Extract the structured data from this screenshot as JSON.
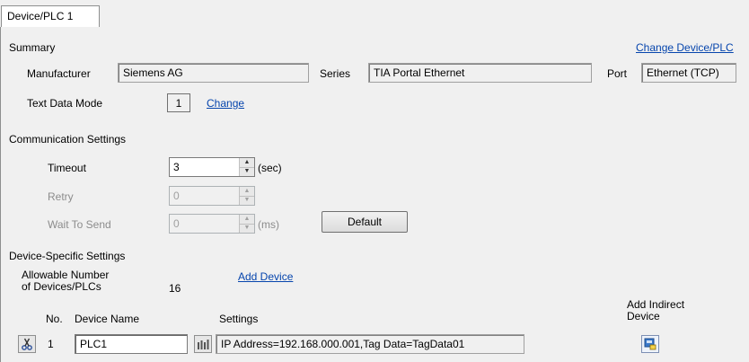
{
  "tab": {
    "label": "Device/PLC 1"
  },
  "summary": {
    "heading": "Summary",
    "change_link": "Change Device/PLC",
    "manufacturer_label": "Manufacturer",
    "manufacturer_value": "Siemens AG",
    "series_label": "Series",
    "series_value": "TIA Portal Ethernet",
    "port_label": "Port",
    "port_value": "Ethernet (TCP)",
    "text_data_mode_label": "Text Data Mode",
    "text_data_mode_value": "1",
    "text_data_mode_change": "Change"
  },
  "comm": {
    "heading": "Communication Settings",
    "timeout_label": "Timeout",
    "timeout_value": "3",
    "timeout_unit": "(sec)",
    "retry_label": "Retry",
    "retry_value": "0",
    "wait_label": "Wait To Send",
    "wait_value": "0",
    "wait_unit": "(ms)",
    "default_button": "Default"
  },
  "device_specific": {
    "heading": "Device-Specific Settings",
    "allowable_line1": "Allowable Number",
    "allowable_line2": "of Devices/PLCs",
    "allowable_value": "16",
    "add_device": "Add Device",
    "col_no": "No.",
    "col_device_name": "Device Name",
    "col_settings": "Settings",
    "col_add_indirect_line1": "Add Indirect",
    "col_add_indirect_line2": "Device",
    "rows": [
      {
        "no": "1",
        "device_name": "PLC1",
        "settings": "IP Address=192.168.000.001,Tag Data=TagData01"
      }
    ]
  },
  "icons": {
    "row_cut": "scissors-icon",
    "row_settings": "settings-grid-icon",
    "add_indirect": "add-indirect-device-icon"
  }
}
